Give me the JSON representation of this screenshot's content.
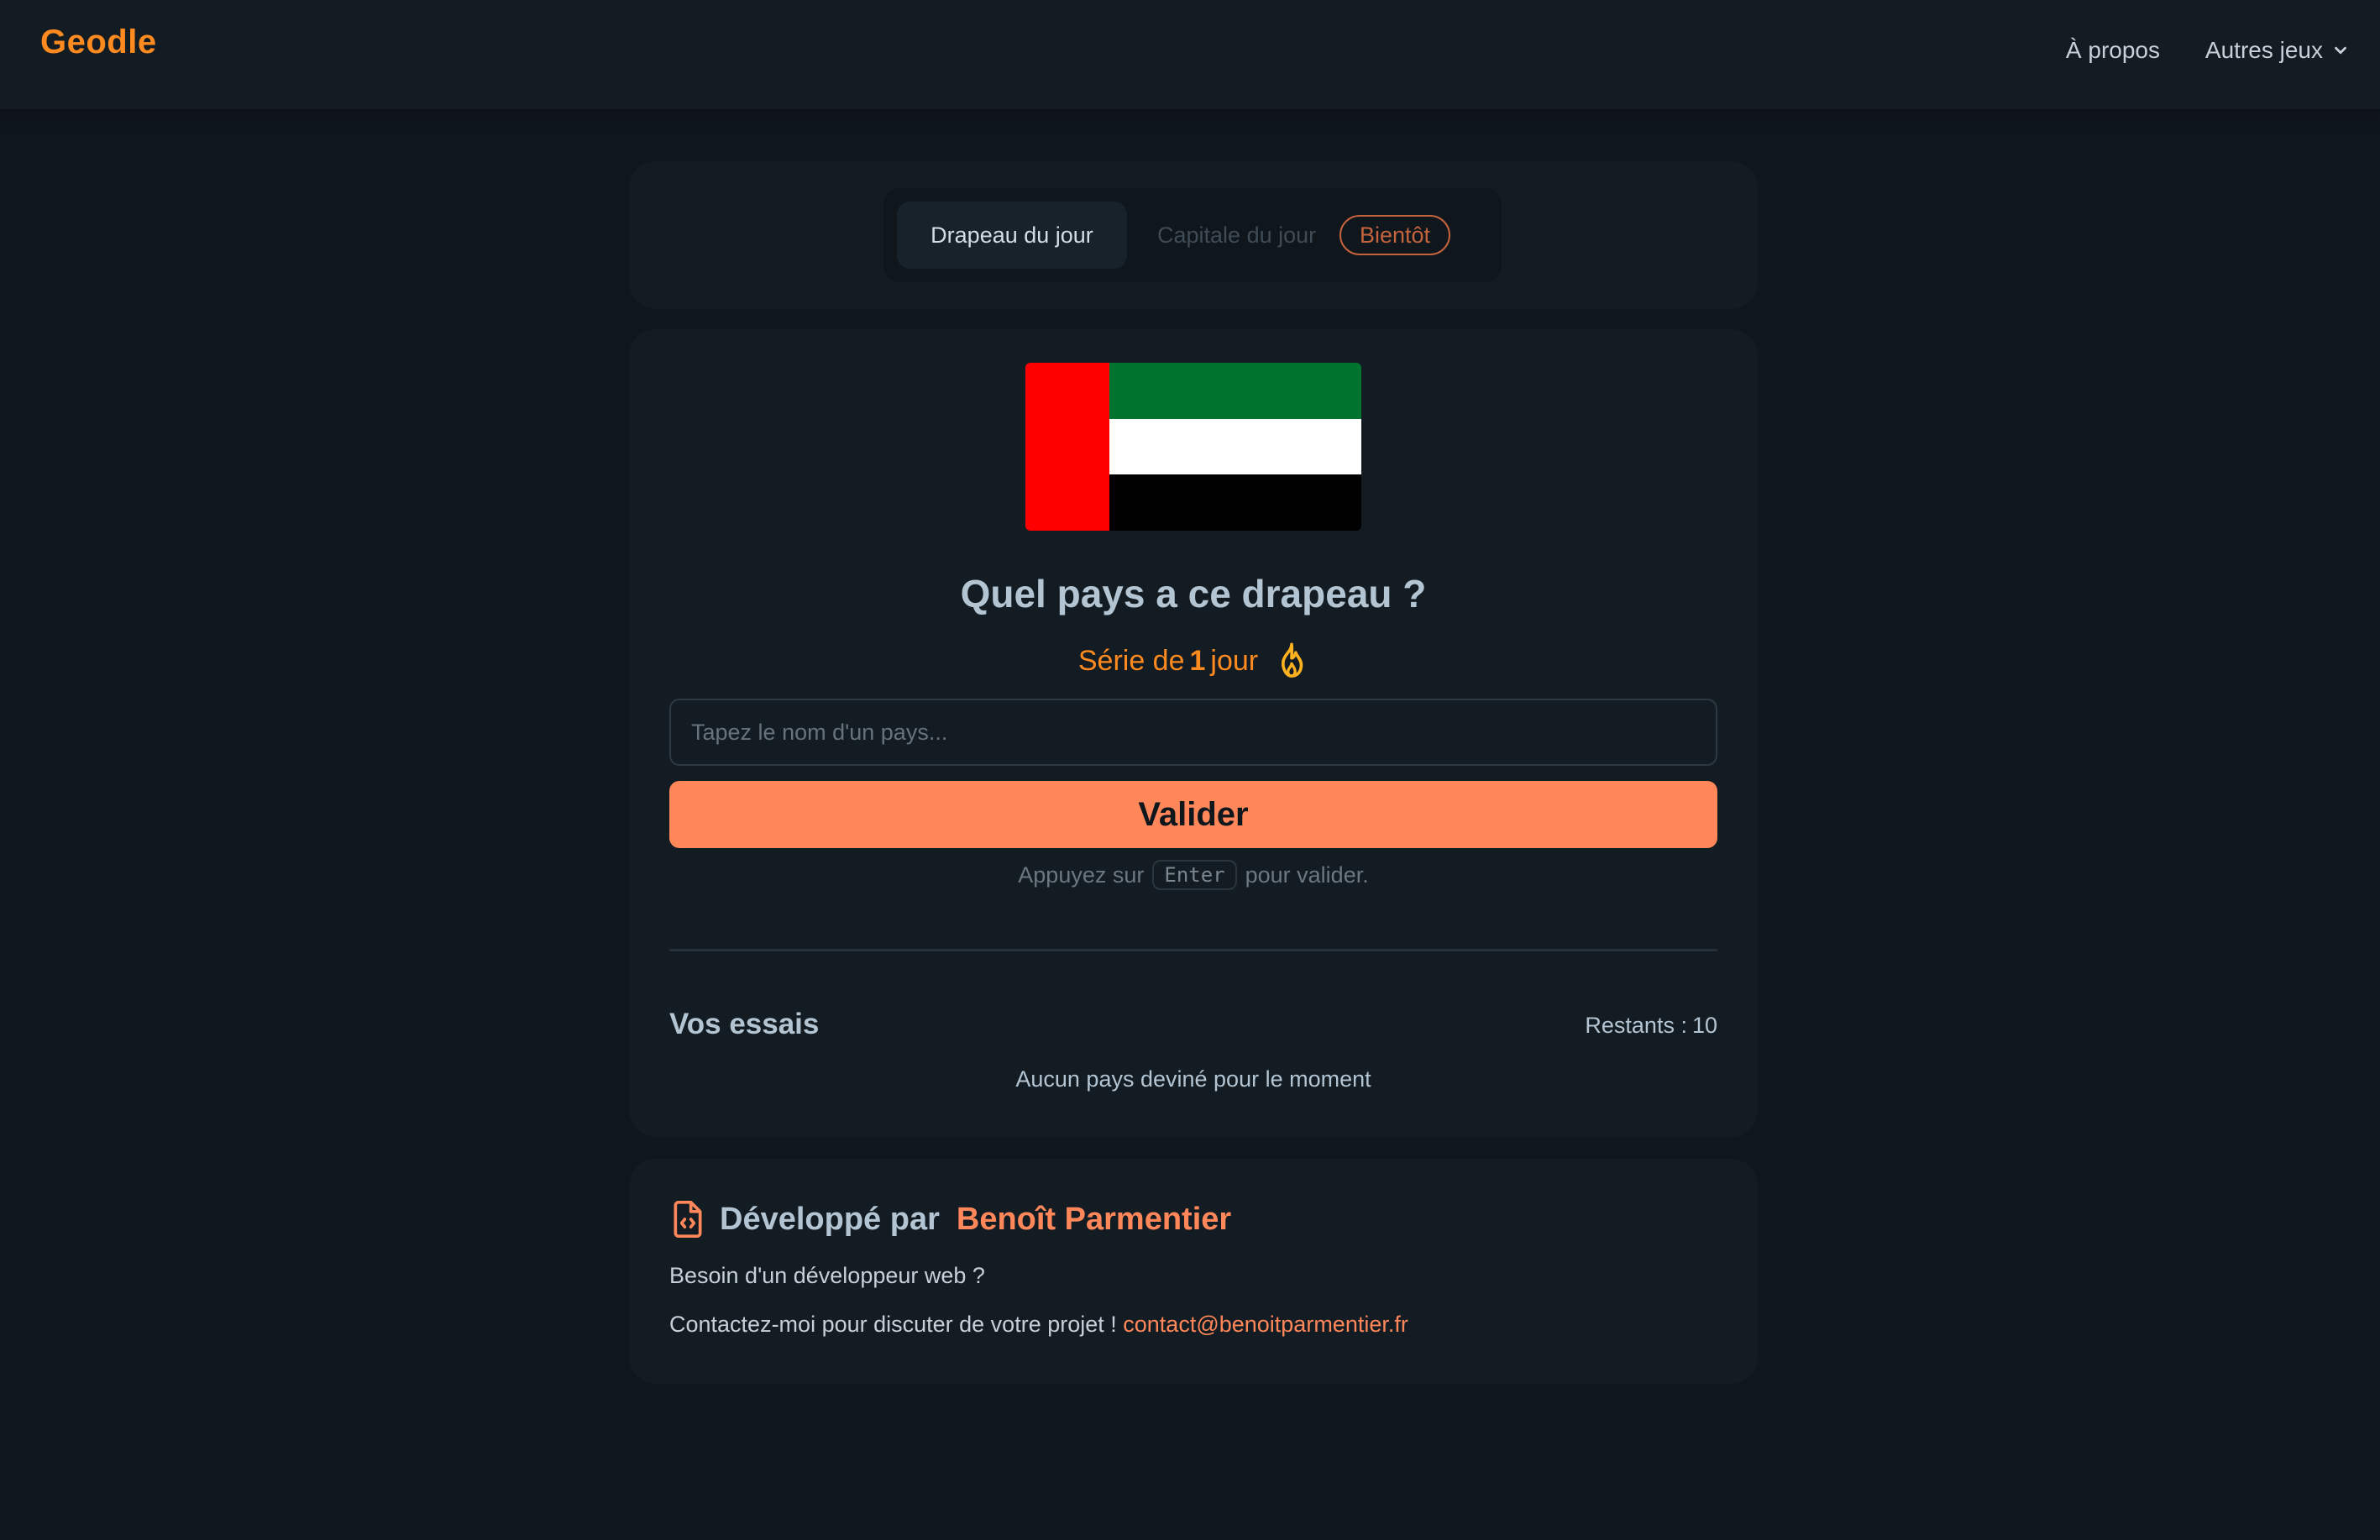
{
  "header": {
    "logo": "Geodle",
    "nav_about": "À propos",
    "nav_other_games": "Autres jeux"
  },
  "tabs": {
    "active": "Drapeau du jour",
    "disabled": "Capitale du jour",
    "badge": "Bientôt"
  },
  "game": {
    "flag": {
      "country_code_hidden": true,
      "colors": {
        "hoist": "#ff0000",
        "top": "#00732f",
        "middle": "#ffffff",
        "bottom": "#000000"
      }
    },
    "question": "Quel pays a ce drapeau ?",
    "streak_prefix": "Série de",
    "streak_count": "1",
    "streak_suffix": "jour",
    "streak_icon": "flame-icon",
    "input_placeholder": "Tapez le nom d'un pays...",
    "input_value": "",
    "submit_label": "Valider",
    "hint_prefix": "Appuyez sur",
    "hint_key": "Enter",
    "hint_suffix": "pour valider.",
    "attempts_title": "Vos essais",
    "remaining_label": "Restants :",
    "remaining_count": "10",
    "empty_message": "Aucun pays deviné pour le moment"
  },
  "footer": {
    "icon": "file-code-icon",
    "title_prefix": "Développé par",
    "author": "Benoît Parmentier",
    "line1": "Besoin d'un développeur web ?",
    "line2_prefix": "Contactez-moi pour discuter de votre projet !",
    "email": "contact@benoitparmentier.fr"
  },
  "colors": {
    "background": "#0f161c",
    "card": "#131c22",
    "accent_orange": "#ff8a1f",
    "button": "#ff875a",
    "badge": "#c4643e"
  }
}
